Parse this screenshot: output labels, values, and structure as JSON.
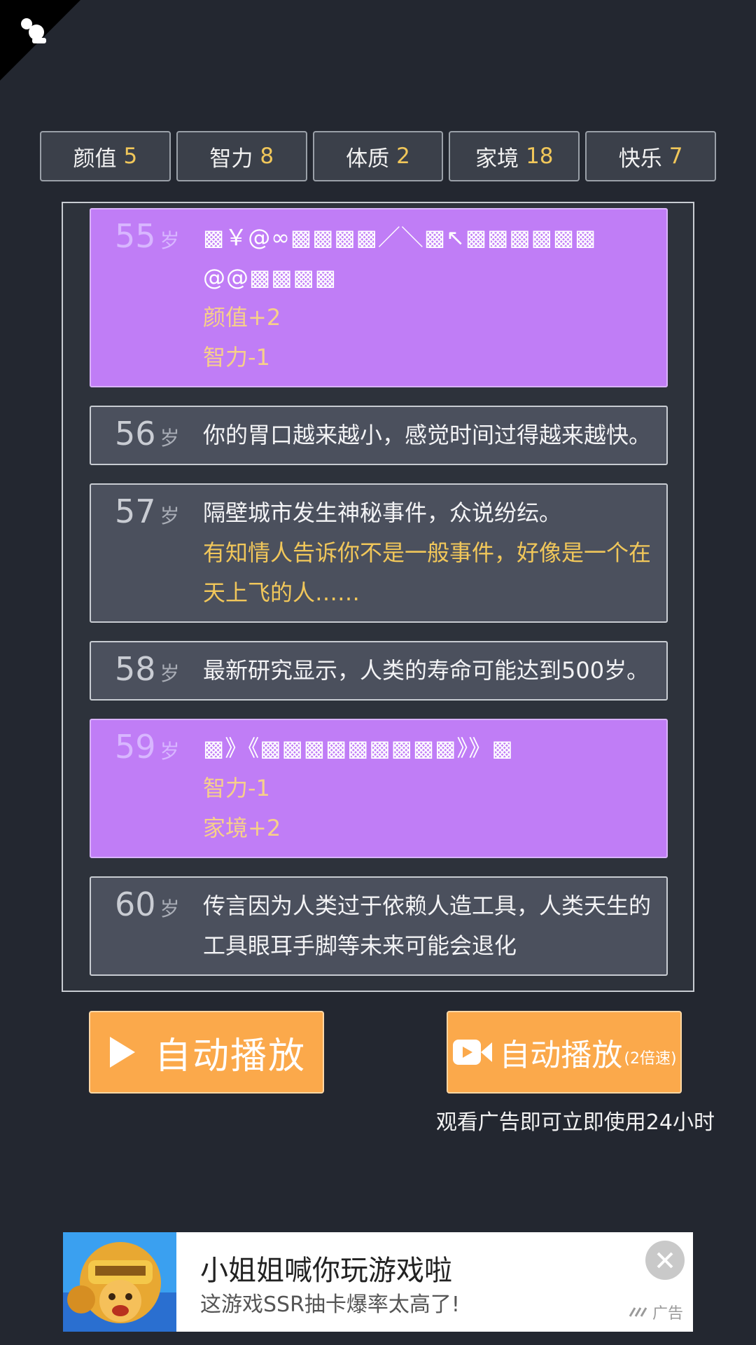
{
  "stats": [
    {
      "label": "颜值",
      "value": "5"
    },
    {
      "label": "智力",
      "value": "8"
    },
    {
      "label": "体质",
      "value": "2"
    },
    {
      "label": "家境",
      "value": "18"
    },
    {
      "label": "快乐",
      "value": "7"
    }
  ],
  "age_unit": "岁",
  "events": [
    {
      "age": "55",
      "style": "purple",
      "lines": [
        {
          "text": "▩￥@∞▩▩▩▩／＼▩↖▩▩▩▩▩▩",
          "kind": "garbled"
        },
        {
          "text": "@@▩▩▩▩",
          "kind": "garbled"
        },
        {
          "text": "颜值+2",
          "kind": "gold"
        },
        {
          "text": "智力-1",
          "kind": "gold"
        }
      ]
    },
    {
      "age": "56",
      "style": "normal",
      "lines": [
        {
          "text": "你的胃口越来越小，感觉时间过得越来越快。",
          "kind": "normal"
        }
      ]
    },
    {
      "age": "57",
      "style": "normal",
      "lines": [
        {
          "text": "隔壁城市发生神秘事件，众说纷纭。",
          "kind": "normal"
        },
        {
          "text": "有知情人告诉你不是一般事件，好像是一个在天上飞的人……",
          "kind": "gold"
        }
      ]
    },
    {
      "age": "58",
      "style": "normal",
      "lines": [
        {
          "text": "最新研究显示，人类的寿命可能达到500岁。",
          "kind": "normal"
        }
      ]
    },
    {
      "age": "59",
      "style": "purple",
      "lines": [
        {
          "text": "▩》《▩▩▩▩▩▩▩▩▩》》▩",
          "kind": "garbled"
        },
        {
          "text": "智力-1",
          "kind": "gold"
        },
        {
          "text": "家境+2",
          "kind": "gold"
        }
      ]
    },
    {
      "age": "60",
      "style": "normal",
      "lines": [
        {
          "text": "传言因为人类过于依赖人造工具，人类天生的工具眼耳手脚等未来可能会退化",
          "kind": "normal"
        }
      ]
    }
  ],
  "buttons": {
    "auto_play": "自动播放",
    "auto_play_ad": "自动播放",
    "auto_play_ad_speed": "(2倍速)"
  },
  "ad_note": "观看广告即可立即使用24小时",
  "banner": {
    "title": "小姐姐喊你玩游戏啦",
    "subtitle": "这游戏SSR抽卡爆率太高了!",
    "tag": "广告"
  },
  "colors": {
    "background": "#232730",
    "card": "#4b505d",
    "card_highlight": "#c07df6",
    "stat_value": "#f1c75a",
    "button": "#fba94b"
  }
}
